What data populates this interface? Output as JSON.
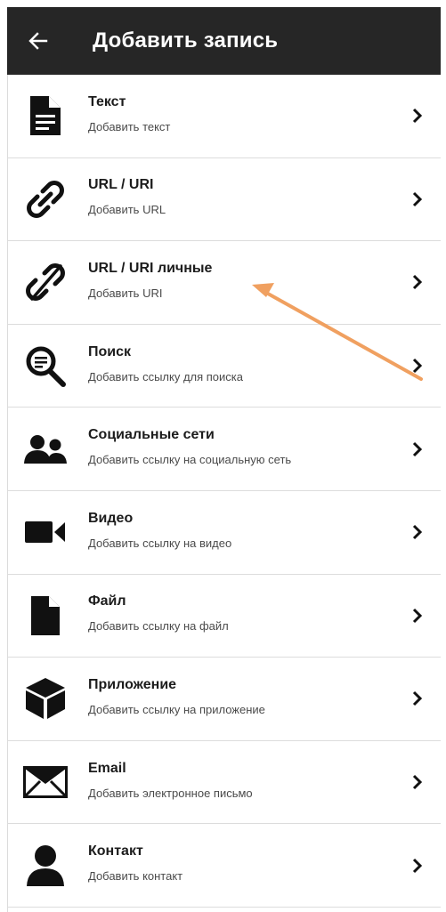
{
  "appbar": {
    "title": "Добавить запись",
    "back_icon": "arrow-left-icon",
    "background": "#262626"
  },
  "items": [
    {
      "title": "Текст",
      "subtitle": "Добавить текст",
      "icon": "document-text-icon"
    },
    {
      "title": "URL / URI",
      "subtitle": "Добавить URL",
      "icon": "link-icon"
    },
    {
      "title": "URL / URI личные",
      "subtitle": "Добавить URI",
      "icon": "link-slash-icon"
    },
    {
      "title": "Поиск",
      "subtitle": "Добавить ссылку для поиска",
      "icon": "search-icon"
    },
    {
      "title": "Социальные сети",
      "subtitle": "Добавить ссылку на социальную сеть",
      "icon": "people-icon"
    },
    {
      "title": "Видео",
      "subtitle": "Добавить ссылку на видео",
      "icon": "video-camera-icon"
    },
    {
      "title": "Файл",
      "subtitle": "Добавить ссылку на файл",
      "icon": "file-icon"
    },
    {
      "title": "Приложение",
      "subtitle": "Добавить ссылку на приложение",
      "icon": "cube-icon"
    },
    {
      "title": "Email",
      "subtitle": "Добавить электронное письмо",
      "icon": "envelope-icon"
    },
    {
      "title": "Контакт",
      "subtitle": "Добавить контакт",
      "icon": "person-icon"
    }
  ],
  "chevron_icon": "chevron-right-icon",
  "annotation": {
    "icon": "annotation-arrow-icon",
    "color": "#f0a060"
  }
}
